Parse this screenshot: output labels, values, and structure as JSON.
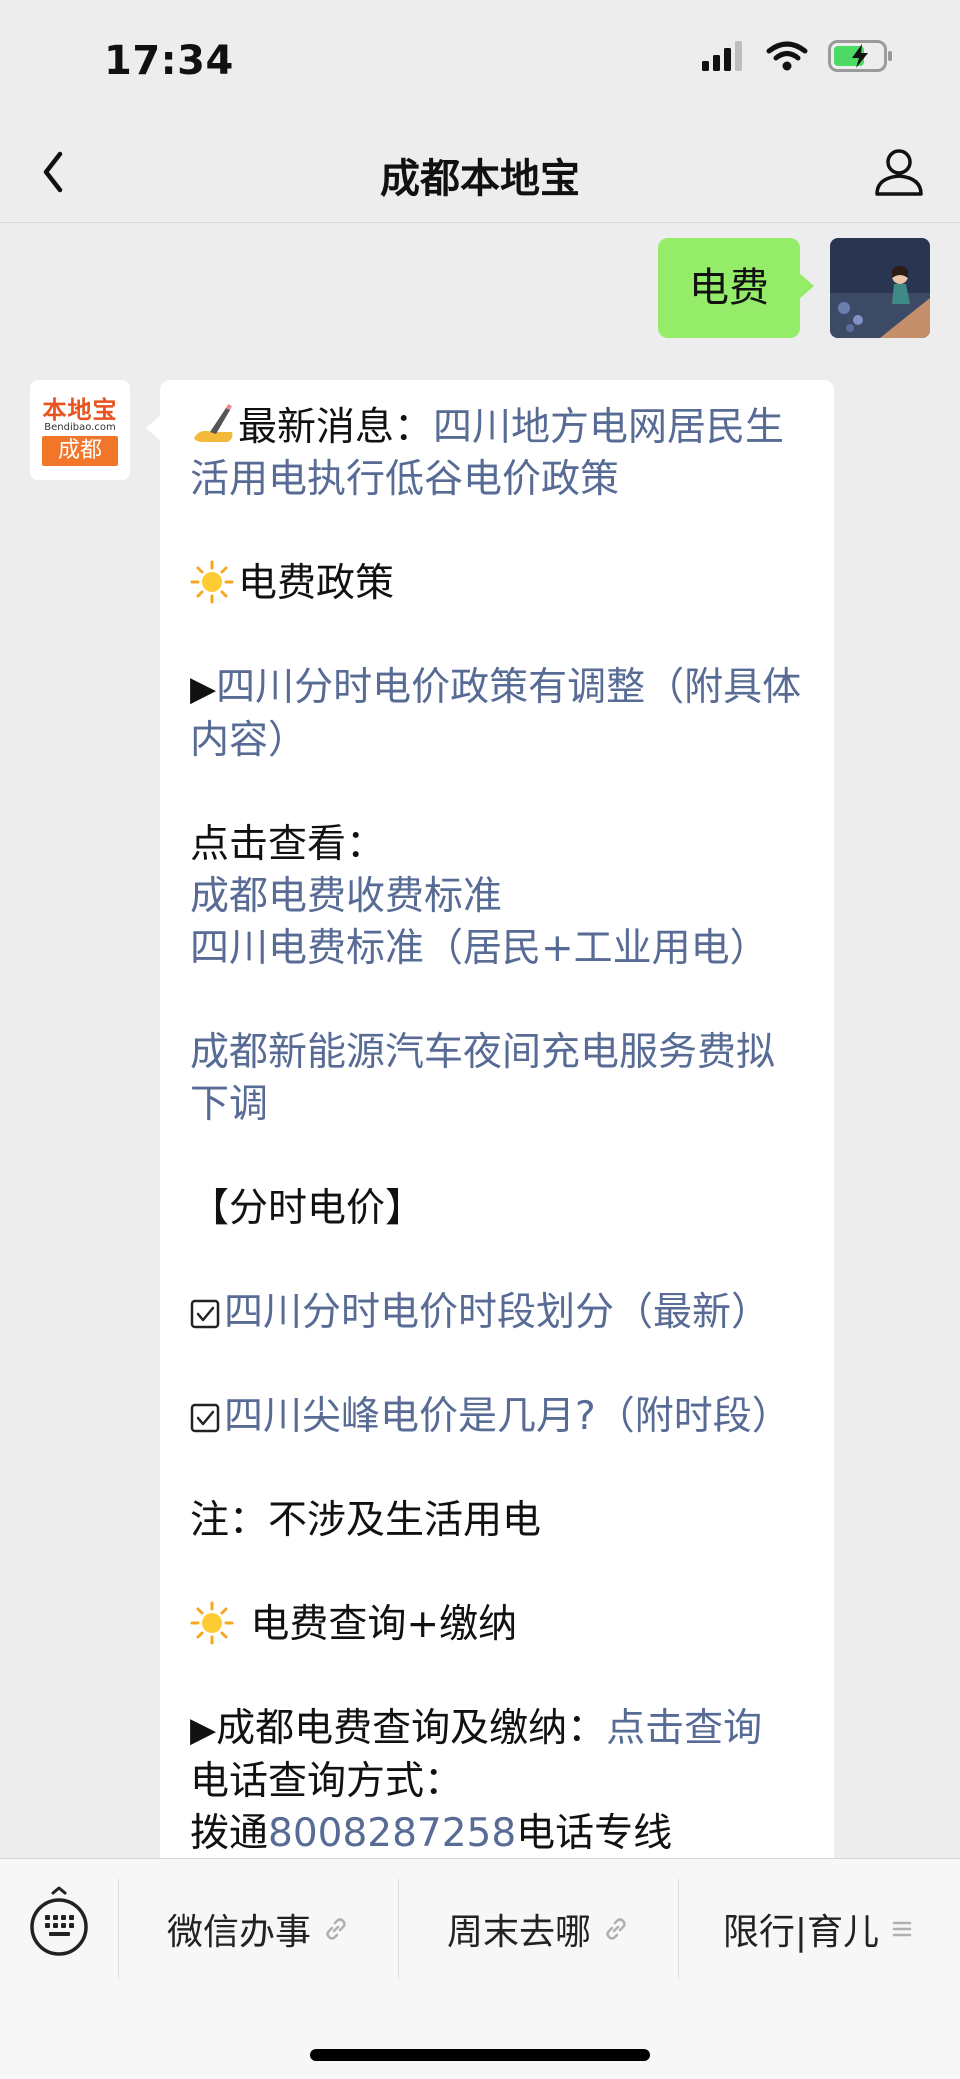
{
  "status_bar": {
    "time": "17:34"
  },
  "nav": {
    "title": "成都本地宝"
  },
  "messages": {
    "user_text": "电费",
    "bot_logo": {
      "top": "本地宝",
      "domain": "Bendibao.com",
      "city": "成都"
    },
    "bot_lines": {
      "l1_prefix": "最新消息：",
      "l1_link": "四川地方电网居民生活用电执行低谷电价政策",
      "l2": "电费政策",
      "l3_link": "四川分时电价政策有调整（附具体内容）",
      "l4": "点击查看：",
      "l5_link": "成都电费收费标准",
      "l6_link": "四川电费标准（居民+工业用电）",
      "l7_link": "成都新能源汽车夜间充电服务费拟下调",
      "l8": "【分时电价】",
      "l9_link": "四川分时电价时段划分（最新）",
      "l10_link": "四川尖峰电价是几月?（附时段）",
      "l11": "注：不涉及生活用电",
      "l12": " 电费查询+缴纳",
      "l13_prefix": "成都电费查询及缴纳：",
      "l13_link": "点击查询",
      "l14": "电话查询方式：",
      "l15_prefix": "拨通",
      "l15_link": "8008287258",
      "l15_suffix": "电话专线"
    }
  },
  "menu": {
    "items": [
      {
        "label": "微信办事",
        "icon": "link-icon"
      },
      {
        "label": "周末去哪",
        "icon": "link-icon"
      },
      {
        "label": "限行|育儿",
        "icon": "list-icon"
      }
    ]
  },
  "colors": {
    "link": "#576b95",
    "user_bubble": "#95ec69",
    "background": "#ededed"
  }
}
